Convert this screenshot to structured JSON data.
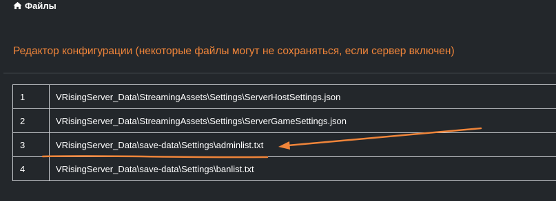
{
  "breadcrumb": {
    "icon": "home-icon",
    "label": "Файлы"
  },
  "section": {
    "title": "Редактор конфигурации (некоторые файлы могут не сохраняться, если сервер включен)"
  },
  "colors": {
    "accent": "#f0853a",
    "background": "#23272b",
    "border": "#c9ccd0"
  },
  "files": [
    {
      "index": "1",
      "path": "VRisingServer_Data\\StreamingAssets\\Settings\\ServerHostSettings.json"
    },
    {
      "index": "2",
      "path": "VRisingServer_Data\\StreamingAssets\\Settings\\ServerGameSettings.json"
    },
    {
      "index": "3",
      "path": "VRisingServer_Data\\save-data\\Settings\\adminlist.txt"
    },
    {
      "index": "4",
      "path": "VRisingServer_Data\\save-data\\Settings\\banlist.txt"
    }
  ]
}
